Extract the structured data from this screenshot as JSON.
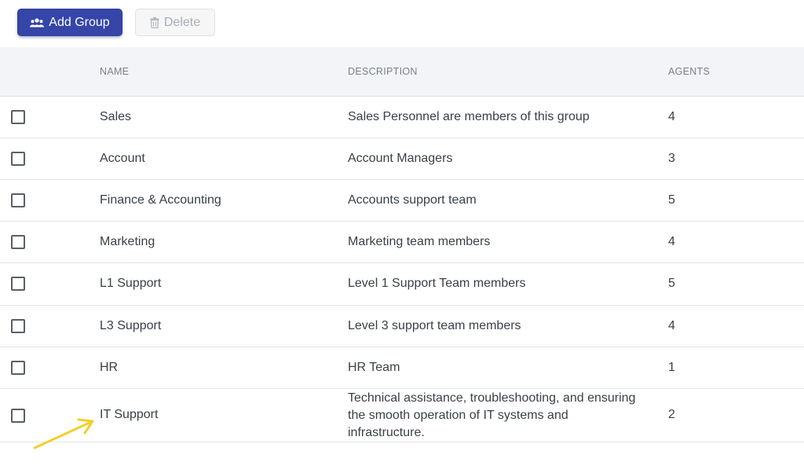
{
  "toolbar": {
    "add_label": "Add Group",
    "delete_label": "Delete",
    "add_icon": "users-icon",
    "delete_icon": "trash-icon"
  },
  "table": {
    "columns": {
      "name": "NAME",
      "description": "DESCRIPTION",
      "agents": "AGENTS"
    },
    "rows": [
      {
        "name": "Sales",
        "description": "Sales Personnel are members of this group",
        "agents": "4"
      },
      {
        "name": "Account",
        "description": "Account Managers",
        "agents": "3"
      },
      {
        "name": "Finance & Accounting",
        "description": "Accounts support team",
        "agents": "5"
      },
      {
        "name": "Marketing",
        "description": "Marketing team members",
        "agents": "4"
      },
      {
        "name": "L1 Support",
        "description": "Level 1 Support Team members",
        "agents": "5"
      },
      {
        "name": "L3 Support",
        "description": "Level 3 support team members",
        "agents": "4"
      },
      {
        "name": "HR",
        "description": "HR Team",
        "agents": "1"
      },
      {
        "name": "IT Support",
        "description": "Technical assistance, troubleshooting, and ensuring the smooth operation of IT systems and infrastructure.",
        "agents": "2"
      }
    ]
  },
  "colors": {
    "primary_button": "#3545a8",
    "annotation_arrow": "#f2cf2e"
  }
}
